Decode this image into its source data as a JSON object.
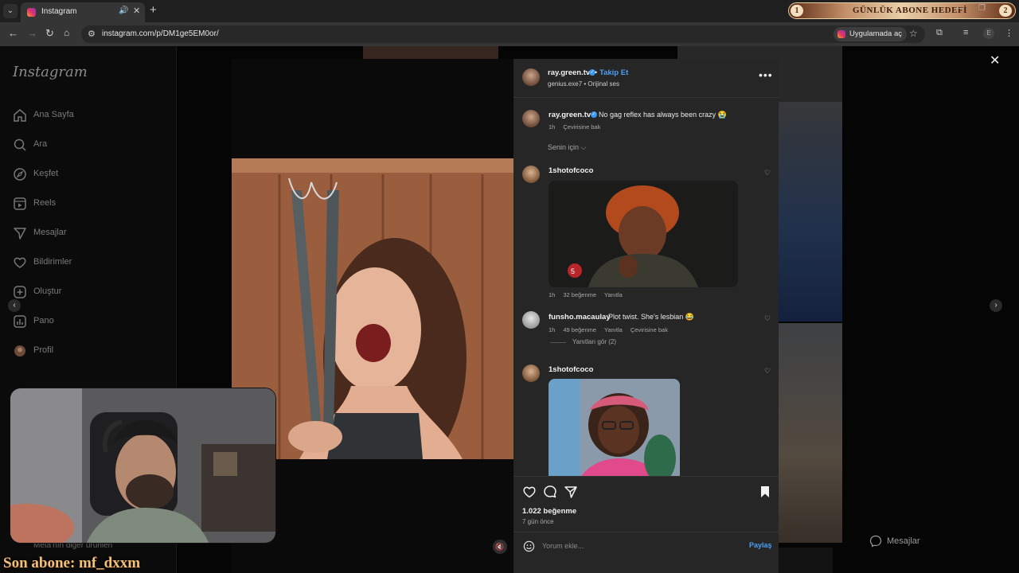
{
  "browser": {
    "tab_title": "Instagram",
    "url": "instagram.com/p/DM1ge5EM0or/",
    "open_in_app": "Uygulamada aç",
    "profile_initial": "E"
  },
  "overlay": {
    "goal_number": "1",
    "goal_text": "GÜNLÜK ABONE HEDEFİ",
    "goal_end": "2",
    "last_sub": "Son abone: mf_dxxm"
  },
  "sidebar": {
    "logo": "Instagram",
    "items": [
      {
        "label": "Ana Sayfa",
        "icon": "home-icon"
      },
      {
        "label": "Ara",
        "icon": "search-icon"
      },
      {
        "label": "Keşfet",
        "icon": "compass-icon"
      },
      {
        "label": "Reels",
        "icon": "reels-icon"
      },
      {
        "label": "Mesajlar",
        "icon": "send-icon"
      },
      {
        "label": "Bildirimler",
        "icon": "heart-icon"
      },
      {
        "label": "Oluştur",
        "icon": "plus-icon"
      },
      {
        "label": "Pano",
        "icon": "dashboard-icon"
      },
      {
        "label": "Profil",
        "icon": "profile-icon"
      }
    ],
    "more": "Meta'nın diğer ürünleri"
  },
  "messages_button": "Mesajlar",
  "post": {
    "username": "ray.green.tv",
    "follow": "Takip Et",
    "sub": "genius.exe7 • Orijinal ses",
    "caption": {
      "username": "ray.green.tv",
      "text": "No gag reflex has always been crazy 😭",
      "time": "1h",
      "translate": "Çevirisine bak"
    },
    "for_you": "Senin için ⌵",
    "comments": [
      {
        "username": "1shotofcoco",
        "time": "1h",
        "likes": "32 beğenme",
        "reply": "Yanıtla"
      },
      {
        "username": "funsho.macaulay",
        "text": "Plot twist. She's lesbian 😂",
        "time": "1h",
        "likes": "49 beğenme",
        "reply": "Yanıtla",
        "translate": "Çevirisine bak",
        "view_replies": "Yanıtları gör (2)"
      },
      {
        "username": "1shotofcoco"
      }
    ],
    "likes": "1.022 beğenme",
    "ago": "7 gün önce",
    "comment_placeholder": "Yorum ekle...",
    "share": "Paylaş"
  }
}
